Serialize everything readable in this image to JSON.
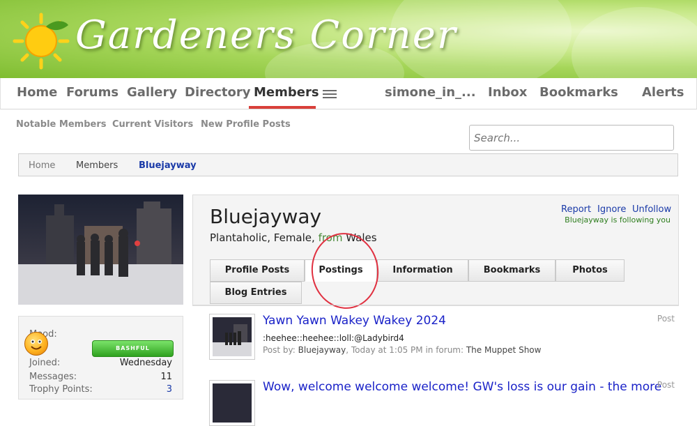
{
  "site": {
    "title": "Gardeners Corner"
  },
  "nav": {
    "items": [
      "Home",
      "Forums",
      "Gallery",
      "Directory",
      "Members"
    ],
    "active": "Members",
    "user": "simone_in_...",
    "inbox": "Inbox",
    "bookmarks": "Bookmarks",
    "alerts": "Alerts"
  },
  "subnav": [
    "Notable Members",
    "Current Visitors",
    "New Profile Posts"
  ],
  "search": {
    "placeholder": "Search..."
  },
  "breadcrumb": [
    "Home",
    "Members",
    "Bluejayway"
  ],
  "profile": {
    "username": "Bluejayway",
    "blurb_start": "Plantaholic, Female, ",
    "blurb_from": "from",
    "blurb_location": " Wales",
    "links": {
      "report": "Report",
      "ignore": "Ignore",
      "unfollow": "Unfollow"
    },
    "following_note": "Bluejayway is following you",
    "tabs": [
      "Profile Posts",
      "Postings",
      "Information",
      "Bookmarks",
      "Photos",
      "Blog Entries"
    ],
    "active_tab": "Postings"
  },
  "sidebar": {
    "mood_label": "Mood:",
    "mood_badge": "BASHFUL",
    "joined_label": "Joined:",
    "joined_value": "Wednesday",
    "messages_label": "Messages:",
    "messages_value": "11",
    "trophy_label": "Trophy Points:",
    "trophy_value": "3"
  },
  "posts": [
    {
      "title": "Yawn Yawn Wakey Wakey 2024",
      "snippet": ":heehee::heehee::loll:@Ladybird4",
      "meta_prefix": "Post by: ",
      "author": "Bluejayway",
      "meta_time": ", Today at 1:05 PM in forum: ",
      "forum": "The Muppet Show",
      "type": "Post"
    },
    {
      "title": "Wow, welcome welcome welcome! GW's loss is our gain - the more",
      "type": "Post"
    }
  ],
  "colors": {
    "active_nav": "#d9403a",
    "link": "#1a3aa8",
    "post_title": "#1a22c8",
    "annotation": "#e03040"
  }
}
